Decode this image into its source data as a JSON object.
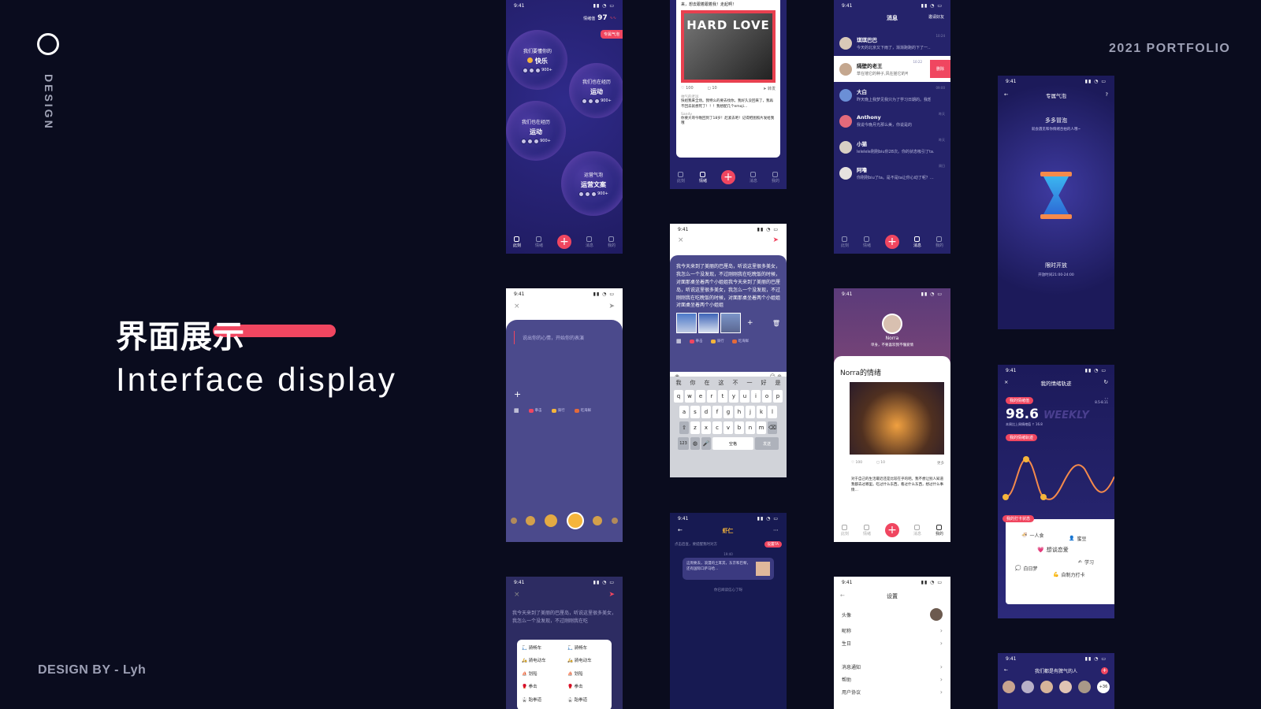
{
  "hero": {
    "vertical_label": "DESIGN",
    "title_cn": "界面展示",
    "title_en": "Interface display",
    "portfolio": "2021 PORTFOLIO",
    "author": "DESIGN BY - Lyh"
  },
  "colors": {
    "accent": "#f04660",
    "bg": "#0a0c1e",
    "navy": "#25236b"
  },
  "status_time": "9:41",
  "screen_bubbles": {
    "header_label": "情绪值",
    "header_value": "97",
    "tag": "专属气泡",
    "bubbles": [
      {
        "title": "我们要懂你的",
        "big": "快乐",
        "count": "900+"
      },
      {
        "title": "我们也在经历",
        "big": "运动",
        "count": "900+"
      },
      {
        "title": "我们也在经历",
        "big": "运动",
        "count": "900+"
      },
      {
        "title": "运营气泡",
        "big": "运营文案",
        "count": "900+"
      }
    ],
    "tabs": [
      "此刻",
      "情绪",
      "消息",
      "我的"
    ]
  },
  "screen_post": {
    "intro": "来，想去跟着跟着我！走起啊！",
    "image_text": "HARD LOVE",
    "likes": "100",
    "comments": "10",
    "share": "转发",
    "comment1_name": "帅气的老逗",
    "comment1": "快组我来全场。我特么的要去找你。我好久没回来了，我再不回去就想死了！！！我想配几个emoji…",
    "comment2_name": "Sandy",
    "comment2": "你要大哥今晚回到了18岁！赶紧去吧！记得把图照片发给我哦",
    "tabs": [
      "此刻",
      "情绪",
      "消息",
      "我的"
    ]
  },
  "screen_messages": {
    "title": "消息",
    "action": "邀请好友",
    "delete": "删除",
    "rows": [
      {
        "name": "琪琪巴巴",
        "text": "今天的北京又下雨了，渐渐跑跑的下了一…",
        "time": "10:24"
      },
      {
        "name": "隔壁的老王",
        "text": "草在墙它的种子,风在摇它的叶子。我们站…",
        "time": "10:22"
      },
      {
        "name": "大白",
        "text": "昨天晚上我梦见我只为了学习日期的。我想…",
        "time": "09:00"
      },
      {
        "name": "Anthony",
        "text": "我说今晚月光那么美，你说是的",
        "time": "昨天"
      },
      {
        "name": "小猫",
        "text": "lelelele刚刚biu你28次。你的状态吸引了ta…",
        "time": "昨天"
      },
      {
        "name": "阿噜",
        "text": "你刚刚biu了ta。是不是ta让你心动了呢？…",
        "time": "周日"
      }
    ],
    "tabs": [
      "此刻",
      "情绪",
      "消息",
      "我的"
    ]
  },
  "screen_bubble_time": {
    "title": "专属气泡",
    "subtitle": "多多冒泡",
    "desc": "就会遇见和你情绪合拍的人哦~",
    "open_label": "限时开放",
    "open_time": "开放时间21:00-24:00"
  },
  "screen_compose_empty": {
    "placeholder": "说出你的心情，开始你的表演",
    "chips": [
      "拳击",
      "骑行",
      "吃海鲜"
    ]
  },
  "screen_compose_kb": {
    "text": "我今天来到了美丽的巴厘岛，听说这里很多美女，我怎么一个没发现，不过刚刚我在吃晚饭的时候，对面那桌坐着两个小姐姐我今天来到了美丽的巴厘岛，听说这里很多美女，我怎么一个没发现，不过刚刚我在吃晚饭的时候，对面那桌坐着两个小姐姐对面桌坐着两个小姐姐",
    "chips": [
      "拳击",
      "骑行",
      "吃海鲜"
    ],
    "candidates": [
      "我",
      "你",
      "在",
      "这",
      "不",
      "一",
      "好",
      "是"
    ],
    "row1": [
      "q",
      "w",
      "e",
      "r",
      "t",
      "y",
      "u",
      "i",
      "o",
      "p"
    ],
    "row2": [
      "a",
      "s",
      "d",
      "f",
      "g",
      "h",
      "j",
      "k",
      "l"
    ],
    "row3": [
      "z",
      "x",
      "c",
      "v",
      "b",
      "n",
      "m"
    ],
    "key_123": "123",
    "key_space": "空格",
    "key_send": "发送"
  },
  "screen_profile": {
    "name": "Norra",
    "bio": "单身，不要喜欢我不懂爱情",
    "title": "Norra的情绪",
    "likes": "100",
    "comments": "10",
    "more": "更多",
    "post": "对于自己的生活最近还是比较在乎的吧。我不想让别人知道我都去过哪里。吃过什么东西，看过什么东西，想过什么事情…",
    "tabs": [
      "此刻",
      "情绪",
      "消息",
      "我的"
    ]
  },
  "screen_trend": {
    "title": "我的情绪轨迹",
    "tag_value": "我的情绪值",
    "score": "98.6",
    "weekly": "WEEKLY",
    "date_range": "8.5-8.11",
    "sub": "本周比上周情绪值",
    "sub_value": "16.8",
    "tag_trend": "我的情绪轨迹",
    "tag_check": "我的打卡状态",
    "checks": [
      "一人食",
      "蜜豆",
      "想谈恋爱",
      "学习",
      "白日梦",
      "自制力打卡"
    ]
  },
  "screen_sports": {
    "text": "我今天来到了美丽的巴厘岛，听说这里很多美女，我怎么一个没发现，不过刚刚我在吃",
    "items": [
      "骑畅车",
      "骑畅车",
      "骑电动车",
      "骑电动车",
      "划船",
      "划船",
      "拳击",
      "拳击",
      "跆拳道",
      "跆拳道"
    ]
  },
  "screen_chat": {
    "title": "虾仁",
    "hint": "点击后查，要提醒我时对方",
    "badge": "设置TA",
    "time": "19:40",
    "bubble": "这周要去，浪漫的土耳其，东京和巴黎，还有国际口萨马哈…",
    "note": "你已阅读信心了呀"
  },
  "screen_settings": {
    "title": "设置",
    "rows": [
      "头像",
      "昵称",
      "生日",
      "消息通知",
      "帮助",
      "用户协议"
    ]
  },
  "screen_temper": {
    "title": "我们都是有脾气的人",
    "more": "+36"
  }
}
